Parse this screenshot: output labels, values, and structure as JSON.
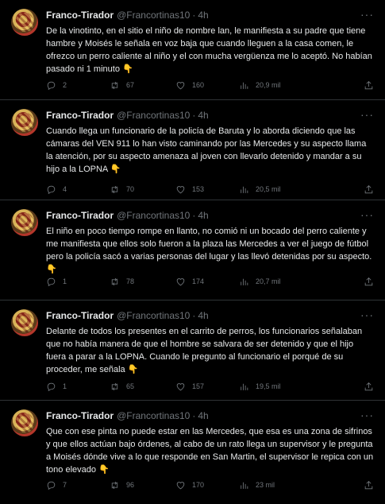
{
  "author": {
    "name": "Franco-Tirador",
    "handle": "@Francortinas10",
    "separator": "·",
    "time": "4h"
  },
  "more_label": "···",
  "tweets": [
    {
      "text": "De la vinotinto, en el sitio el niño de nombre lan, le manifiesta a su padre que tiene hambre y Moisés le señala en voz baja que cuando lleguen a la casa comen, le ofrezco un perro caliente al niño y el con mucha vergüenza me lo aceptó. No habían pasado ni 1 minuto",
      "emoji": "👇",
      "replies": "2",
      "retweets": "67",
      "likes": "160",
      "views": "20,9 mil"
    },
    {
      "text": "Cuando llega un funcionario de la policía de Baruta y lo aborda diciendo que las cámaras del VEN 911 lo han visto caminando por las Mercedes y su aspecto llama la atención, por su aspecto amenaza al joven con llevarlo detenido y mandar a su hijo a la LOPNA",
      "emoji": "👇",
      "replies": "4",
      "retweets": "70",
      "likes": "153",
      "views": "20,5 mil"
    },
    {
      "text": "El niño en poco tiempo rompe en llanto, no comió ni un bocado del perro caliente y me manifiesta que ellos solo fueron a la plaza las Mercedes a ver el juego de fútbol pero la policía sacó a varias personas del lugar y las llevó detenidas por su aspecto.",
      "emoji": "👇",
      "replies": "1",
      "retweets": "78",
      "likes": "174",
      "views": "20,7 mil"
    },
    {
      "text": "Delante de todos los presentes en el carrito de perros, los funcionarios señalaban que no había manera de que el hombre se salvara de ser detenido y que el hijo fuera a parar a la LOPNA. Cuando le pregunto al funcionario el porqué de su proceder, me señala",
      "emoji": "👇",
      "replies": "1",
      "retweets": "65",
      "likes": "157",
      "views": "19,5 mil"
    },
    {
      "text": "Que con ese pinta no puede estar en las Mercedes, que esa es una zona de sifrinos y que ellos actúan bajo órdenes, al cabo de un rato llega un supervisor y le pregunta a Moisés dónde vive a lo que responde en San Martin, el supervisor le repica con un tono elevado",
      "emoji": "👇",
      "replies": "7",
      "retweets": "96",
      "likes": "170",
      "views": "23 mil"
    }
  ]
}
